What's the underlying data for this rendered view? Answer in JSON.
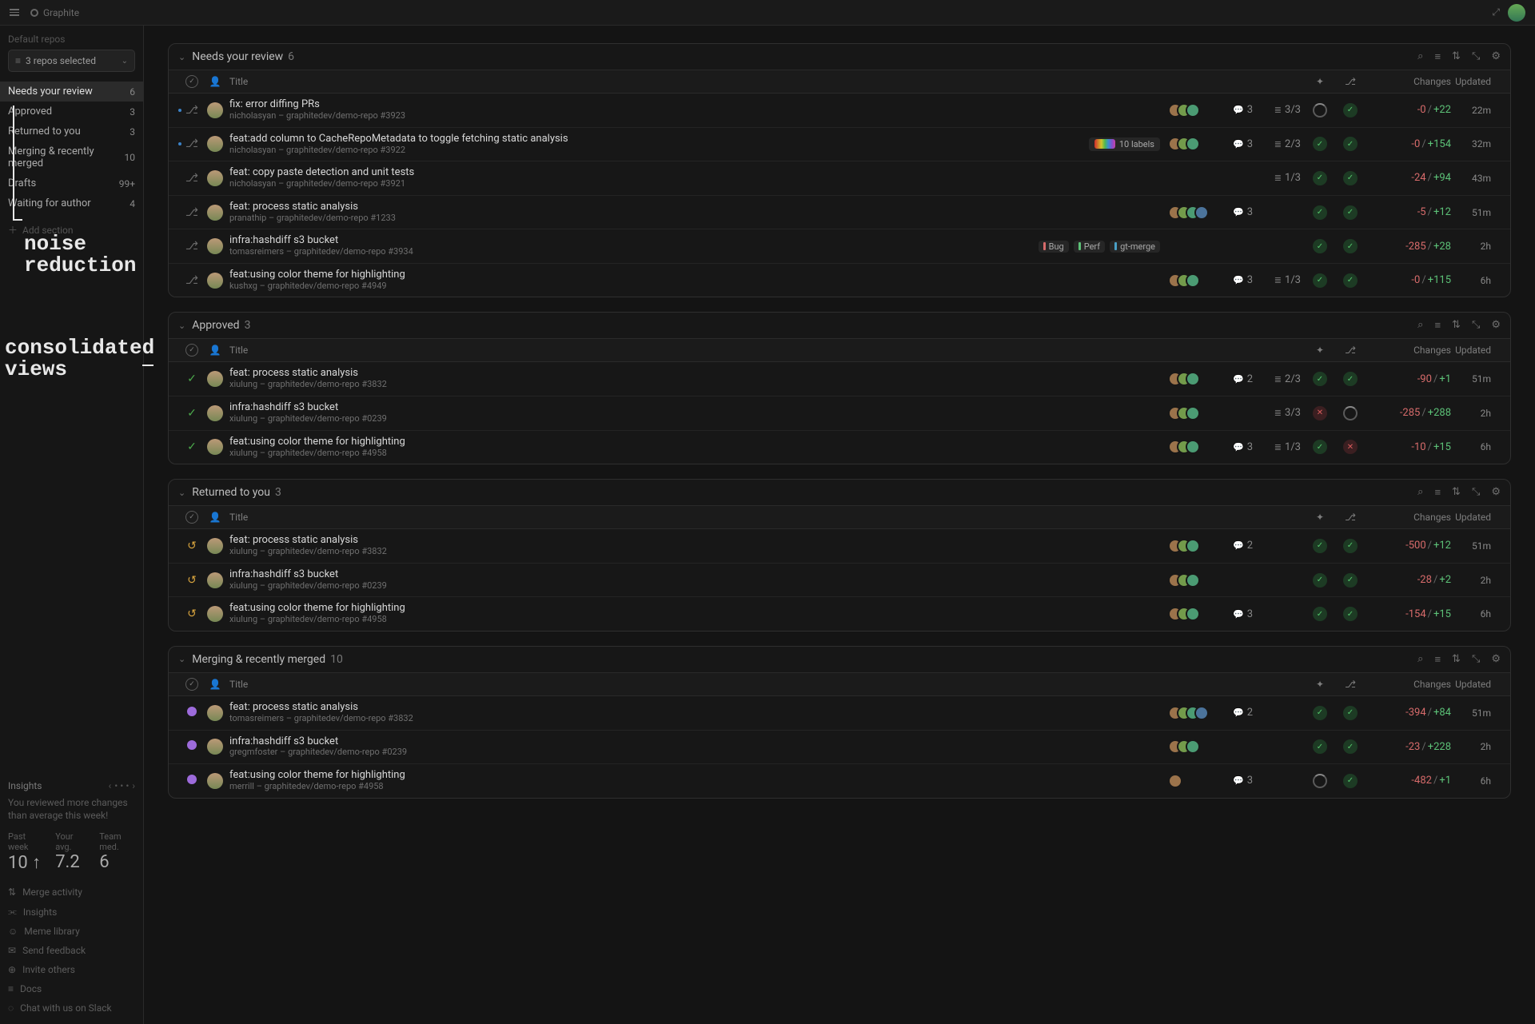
{
  "brand": "Graphite",
  "sidebar": {
    "default_repos_label": "Default repos",
    "repo_selector": "3 repos selected",
    "items": [
      {
        "label": "Needs your review",
        "count": "6"
      },
      {
        "label": "Approved",
        "count": "3"
      },
      {
        "label": "Returned to you",
        "count": "3"
      },
      {
        "label": "Merging & recently merged",
        "count": "10"
      },
      {
        "label": "Drafts",
        "count": "99+"
      },
      {
        "label": "Waiting for author",
        "count": "4"
      }
    ],
    "add_section": "Add section",
    "insights": {
      "title": "Insights",
      "message": "You reviewed more changes than average this week!",
      "stats": [
        {
          "label": "Past week",
          "value": "10 ↑"
        },
        {
          "label": "Your avg.",
          "value": "7.2"
        },
        {
          "label": "Team med.",
          "value": "6"
        }
      ]
    },
    "bottom_links": [
      "Merge activity",
      "Insights",
      "Meme library",
      "Send feedback",
      "Invite others",
      "Docs",
      "Chat with us on Slack"
    ]
  },
  "columns": {
    "title": "Title",
    "changes": "Changes",
    "updated": "Updated"
  },
  "sections": [
    {
      "title": "Needs your review",
      "count": "6",
      "icon": "pr",
      "rows": [
        {
          "dot": true,
          "title": "fix: error diffing PRs",
          "sub": "nicholasyan – graphitedev/demo-repo #3923",
          "pile": 3,
          "cm": "3",
          "stack": "3/3",
          "s1": "pending",
          "s2": "pass",
          "neg": "-0",
          "pos": "+22",
          "upd": "22m",
          "labels": []
        },
        {
          "dot": true,
          "title": "feat:add column to CacheRepoMetadata to toggle fetching static analysis",
          "sub": "nicholasyan – graphitedev/demo-repo #3922",
          "pile": 3,
          "cm": "3",
          "stack": "2/3",
          "s1": "pass",
          "s2": "pass",
          "neg": "-0",
          "pos": "+154",
          "upd": "32m",
          "labels": [],
          "rainbow": "10 labels"
        },
        {
          "title": "feat: copy paste detection and unit tests",
          "sub": "nicholasyan – graphitedev/demo-repo #3921",
          "pile": 0,
          "cm": "",
          "stack": "1/3",
          "s1": "pass",
          "s2": "pass",
          "neg": "-24",
          "pos": "+94",
          "upd": "43m",
          "labels": []
        },
        {
          "title": "feat: process static analysis",
          "sub": "pranathip – graphitedev/demo-repo #1233",
          "pile": 4,
          "cm": "3",
          "stack": "",
          "s1": "pass",
          "s2": "pass",
          "neg": "-5",
          "pos": "+12",
          "upd": "51m",
          "labels": []
        },
        {
          "title": "infra:hashdiff s3 bucket",
          "sub": "tomasreimers – graphitedev/demo-repo #3934",
          "pile": 0,
          "cm": "",
          "stack": "",
          "s1": "pass",
          "s2": "pass",
          "neg": "-285",
          "pos": "+28",
          "upd": "2h",
          "labels": [
            {
              "t": "Bug",
              "c": "#d76b6b"
            },
            {
              "t": "Perf",
              "c": "#5cc177"
            },
            {
              "t": "gt-merge",
              "c": "#4aa0c6"
            }
          ]
        },
        {
          "title": "feat:using color theme for highlighting",
          "sub": "kushxg – graphitedev/demo-repo #4949",
          "pile": 3,
          "cm": "3",
          "stack": "1/3",
          "s1": "pass",
          "s2": "pass",
          "neg": "-0",
          "pos": "+115",
          "upd": "6h",
          "labels": []
        }
      ]
    },
    {
      "title": "Approved",
      "count": "3",
      "icon": "appr",
      "rows": [
        {
          "title": "feat: process static analysis",
          "sub": "xiulung – graphitedev/demo-repo #3832",
          "pile": 3,
          "cm": "2",
          "stack": "2/3",
          "s1": "pass",
          "s2": "pass",
          "neg": "-90",
          "pos": "+1",
          "upd": "51m",
          "labels": []
        },
        {
          "title": "infra:hashdiff s3 bucket",
          "sub": "xiulung – graphitedev/demo-repo #0239",
          "pile": 3,
          "cm": "",
          "stack": "3/3",
          "s1": "fail",
          "s2": "pending",
          "neg": "-285",
          "pos": "+288",
          "upd": "2h",
          "labels": []
        },
        {
          "title": "feat:using color theme for highlighting",
          "sub": "xiulung – graphitedev/demo-repo #4958",
          "pile": 3,
          "cm": "3",
          "stack": "1/3",
          "s1": "pass",
          "s2": "fail",
          "neg": "-10",
          "pos": "+15",
          "upd": "6h",
          "labels": []
        }
      ]
    },
    {
      "title": "Returned to you",
      "count": "3",
      "icon": "ret",
      "rows": [
        {
          "title": "feat: process static analysis",
          "sub": "xiulung – graphitedev/demo-repo #3832",
          "pile": 3,
          "cm": "2",
          "stack": "",
          "s1": "pass",
          "s2": "pass",
          "neg": "-500",
          "pos": "+12",
          "upd": "51m",
          "labels": []
        },
        {
          "title": "infra:hashdiff s3 bucket",
          "sub": "xiulung – graphitedev/demo-repo #0239",
          "pile": 3,
          "cm": "",
          "stack": "",
          "s1": "pass",
          "s2": "pass",
          "neg": "-28",
          "pos": "+2",
          "upd": "2h",
          "labels": []
        },
        {
          "title": "feat:using color theme for highlighting",
          "sub": "xiulung – graphitedev/demo-repo #4958",
          "pile": 3,
          "cm": "3",
          "stack": "",
          "s1": "pass",
          "s2": "pass",
          "neg": "-154",
          "pos": "+15",
          "upd": "6h",
          "labels": []
        }
      ]
    },
    {
      "title": "Merging & recently merged",
      "count": "10",
      "icon": "merge",
      "rows": [
        {
          "title": "feat: process static analysis",
          "sub": "tomasreimers – graphitedev/demo-repo #3832",
          "pile": 4,
          "cm": "2",
          "stack": "",
          "s1": "pass",
          "s2": "pass",
          "neg": "-394",
          "pos": "+84",
          "upd": "51m",
          "labels": []
        },
        {
          "title": "infra:hashdiff s3 bucket",
          "sub": "gregmfoster – graphitedev/demo-repo #0239",
          "pile": 3,
          "cm": "",
          "stack": "",
          "s1": "pass",
          "s2": "pass",
          "neg": "-23",
          "pos": "+228",
          "upd": "2h",
          "labels": []
        },
        {
          "title": "feat:using color theme for highlighting",
          "sub": "merrill – graphitedev/demo-repo #4958",
          "pile": 1,
          "cm": "3",
          "stack": "",
          "s1": "pending",
          "s2": "pass",
          "neg": "-482",
          "pos": "+1",
          "upd": "6h",
          "labels": []
        }
      ]
    }
  ],
  "annotations": {
    "noise": "noise\nreduction",
    "views": "consolidated\nviews"
  }
}
